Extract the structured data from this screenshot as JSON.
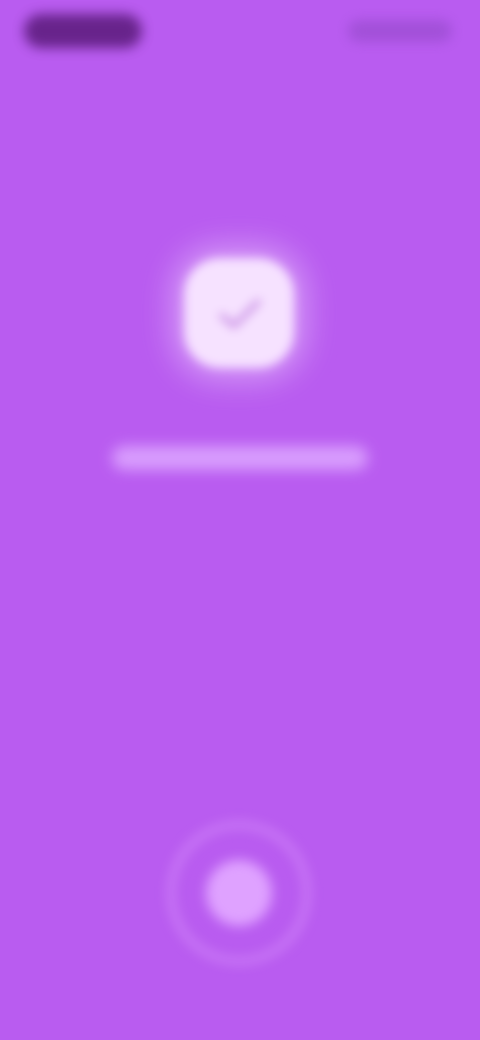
{
  "colors": {
    "background": "#b95cf0",
    "badge": "#f6e2ff",
    "message": "#f1dcff",
    "action_button": "#dfa2ff"
  },
  "status_bar": {
    "left_icon": "time-pill",
    "right_icon": "status-icons"
  },
  "center": {
    "icon": "checkmark-icon"
  },
  "bottom": {
    "icon": "record-button-icon"
  }
}
